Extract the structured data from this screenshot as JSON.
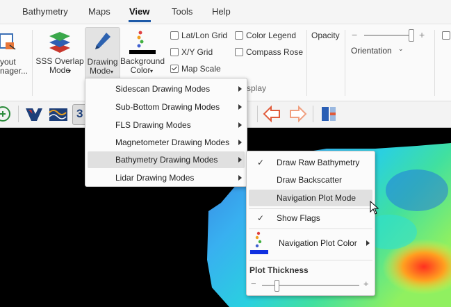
{
  "menubar": {
    "tabs": [
      "Bathymetry",
      "Maps",
      "View",
      "Tools",
      "Help"
    ],
    "active_tab": "View"
  },
  "ribbon": {
    "layout_manager_label_1": "yout",
    "layout_manager_label_2": "nager...",
    "sss_overlap_label_1": "SSS Overlap",
    "sss_overlap_label_2": "Mode",
    "drawing_mode_label_1": "Drawing",
    "drawing_mode_label_2": "Mode",
    "background_color_label_1": "Background",
    "background_color_label_2": "Color",
    "checkboxes": [
      {
        "label": "Lat/Lon Grid",
        "checked": false
      },
      {
        "label": "X/Y Grid",
        "checked": false
      },
      {
        "label": "Map Scale",
        "checked": true
      },
      {
        "label": "Color Legend",
        "checked": false
      },
      {
        "label": "Compass Rose",
        "checked": false
      }
    ],
    "group_label_partial": "splay",
    "opacity_label": "Opacity",
    "orientation_label": "Orientation",
    "minus": "−",
    "plus": "+"
  },
  "drawing_mode_menu": {
    "items": [
      "Sidescan Drawing Modes",
      "Sub-Bottom Drawing Modes",
      "FLS Drawing Modes",
      "Magnetometer Drawing Modes",
      "Bathymetry Drawing Modes",
      "Lidar Drawing Modes"
    ],
    "highlighted_index": 4
  },
  "bathymetry_submenu": {
    "draw_raw": "Draw Raw Bathymetry",
    "draw_backscatter": "Draw Backscatter",
    "navigation_plot_mode": "Navigation Plot Mode",
    "show_flags": "Show Flags",
    "navigation_plot_color": "Navigation Plot Color",
    "plot_thickness_label": "Plot Thickness",
    "minus": "−",
    "plus": "+",
    "checkmark": "✓"
  },
  "colors": {
    "accent": "#1e5aa8",
    "menu_highlight": "#e0e0e0"
  }
}
